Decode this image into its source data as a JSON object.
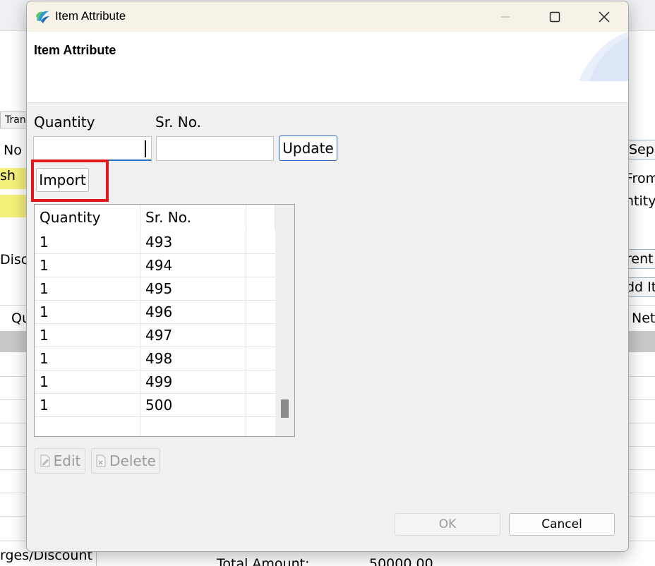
{
  "background_app": {
    "tab_label": "Tran",
    "field_no": "No",
    "field_sh": "sh",
    "field_disc": "Disc",
    "column_qu": "Qu",
    "field_sep": "Sep",
    "field_from": "From",
    "field_ntity": "ntity",
    "button_rent": "rent",
    "button_add_item": "dd It",
    "column_net": "Net",
    "charges_discount": "rges/Discount",
    "total_amount_label": "Total Amount:",
    "total_amount_value": "50000.00"
  },
  "dialog": {
    "title": "Item Attribute",
    "header_title": "Item Attribute",
    "quantity_label": "Quantity",
    "sr_no_label": "Sr. No.",
    "quantity_value": "",
    "sr_no_value": "",
    "update_label": "Update",
    "import_label": "Import",
    "grid": {
      "columns": [
        "Quantity",
        "Sr. No.",
        ""
      ],
      "rows": [
        {
          "quantity": "1",
          "sr_no": "493"
        },
        {
          "quantity": "1",
          "sr_no": "494"
        },
        {
          "quantity": "1",
          "sr_no": "495"
        },
        {
          "quantity": "1",
          "sr_no": "496"
        },
        {
          "quantity": "1",
          "sr_no": "497"
        },
        {
          "quantity": "1",
          "sr_no": "498"
        },
        {
          "quantity": "1",
          "sr_no": "499"
        },
        {
          "quantity": "1",
          "sr_no": "500"
        }
      ]
    },
    "edit_label": "Edit",
    "delete_label": "Delete",
    "ok_label": "OK",
    "cancel_label": "Cancel"
  },
  "colors": {
    "highlight_box": "#e0181e",
    "accent_blue": "#2b6bc1",
    "titlebar": "#f7f2e8",
    "yellow_field": "#f5f07a"
  },
  "icons": {
    "app": "app-logo-icon",
    "minimize": "minimize-icon",
    "maximize": "maximize-icon",
    "close": "close-icon",
    "edit": "edit-icon",
    "delete": "delete-icon"
  }
}
